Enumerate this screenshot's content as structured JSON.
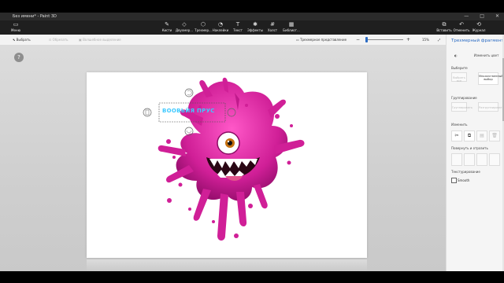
{
  "window": {
    "title": "Без имени* - Paint 3D",
    "buttons": [
      "—",
      "□",
      "✕"
    ]
  },
  "ribbon": {
    "menu_label": "Меню",
    "tools": [
      {
        "label": "Кисти",
        "icon": "brush-icon"
      },
      {
        "label": "Двухмер...",
        "icon": "2d-shapes-icon"
      },
      {
        "label": "Трехмер...",
        "icon": "3d-shapes-icon"
      },
      {
        "label": "Наклейки",
        "icon": "stickers-icon"
      },
      {
        "label": "Текст",
        "icon": "text-icon"
      },
      {
        "label": "Эффекты",
        "icon": "effects-icon"
      },
      {
        "label": "Холст",
        "icon": "canvas-icon"
      },
      {
        "label": "Библиот...",
        "icon": "library-icon"
      }
    ],
    "right_tools": [
      {
        "label": "Вставить",
        "icon": "paste-icon"
      },
      {
        "label": "Отменить",
        "icon": "undo-icon"
      },
      {
        "label": "Журнал",
        "icon": "history-icon"
      }
    ]
  },
  "command_bar": {
    "select_label": "Выбрать",
    "crop_label": "Обрезать",
    "magic_label": "Волшебное выделение",
    "view3d_label": "Трехмерное представление",
    "zoom_value": "15%"
  },
  "canvas": {
    "text_object": "ВООВЬЙЯ ПРУС"
  },
  "panel": {
    "title": "Трехмерный фрагмент",
    "change_color": "Изменить цвет",
    "select_header": "Выберите",
    "select_buttons": [
      "Выбрать все",
      "Множественный выбор"
    ],
    "group_header": "Группирование",
    "group_buttons": [
      "Группировать",
      "Разгруппировать"
    ],
    "edit_header": "Изменить",
    "edit_icons": [
      "scissors-icon",
      "copy-icon",
      "paste-icon",
      "delete-icon"
    ],
    "rotate_header": "Повернуть и отразить",
    "texture_header": "Текстурирование",
    "smooth_label": "Smooth"
  },
  "colors": {
    "accent": "#2b6cc4",
    "character_magenta": "#d01f97",
    "text_cyan": "#3ec9ff"
  }
}
